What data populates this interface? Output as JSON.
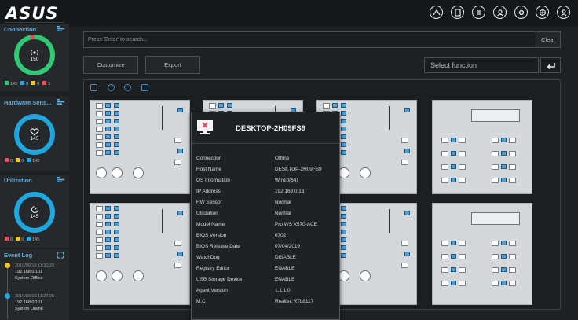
{
  "brand": {
    "logo": "ASUS"
  },
  "top_icons": [
    "network-icon",
    "remote-icon",
    "list-icon",
    "users-icon",
    "settings-icon",
    "globe-icon",
    "account-icon"
  ],
  "sidebar": {
    "connection": {
      "title": "Connection",
      "center": "150",
      "legend": [
        "145",
        "0",
        "0",
        "5"
      ]
    },
    "hardware": {
      "title": "Hardware Sens...",
      "center": "145",
      "legend": [
        "0",
        "0",
        "145"
      ]
    },
    "utilization": {
      "title": "Utilization",
      "center": "145",
      "legend": [
        "0",
        "0",
        "145"
      ]
    },
    "event_log": {
      "title": "Event Log",
      "events": [
        {
          "time": "2019/09/10 11:30:33",
          "ip": "192.168.0.101",
          "msg": "System Offline"
        },
        {
          "time": "2019/09/10 11:27:28",
          "ip": "192.168.0.101",
          "msg": "System Online"
        }
      ]
    }
  },
  "search": {
    "placeholder": "Press 'Enter' to search...",
    "clear": "Clear"
  },
  "toolbar": {
    "customize": "Customize",
    "export": "Export",
    "select_function": "Select function"
  },
  "colors": {
    "accent": "#1ea7e1",
    "online": "#2fc873",
    "offline": "#e84b5a",
    "warning": "#f2c81e"
  },
  "device": {
    "name": "DESKTOP-2H09FS9",
    "fields": [
      {
        "k": "Connection",
        "v": "Offline"
      },
      {
        "k": "Host Name",
        "v": "DESKTOP-2H09FS9"
      },
      {
        "k": "OS Information",
        "v": "Win10(64)"
      },
      {
        "k": "IP Address",
        "v": "192.168.0.13"
      },
      {
        "k": "HW Sensor",
        "v": "Normal"
      },
      {
        "k": "Utilization",
        "v": "Normal"
      },
      {
        "k": "Model Name",
        "v": "Pro WS X570-ACE"
      },
      {
        "k": "BIOS Version",
        "v": "0702"
      },
      {
        "k": "BIOS Release Date",
        "v": "07/04/2019"
      },
      {
        "k": "WatchDog",
        "v": "DISABLE"
      },
      {
        "k": "Registry Editor",
        "v": "ENABLE"
      },
      {
        "k": "USB Storage Device",
        "v": "ENABLE"
      },
      {
        "k": "Agent Version",
        "v": "1.1.1.0"
      },
      {
        "k": "M.C",
        "v": "Realtek RTL8117"
      }
    ]
  }
}
